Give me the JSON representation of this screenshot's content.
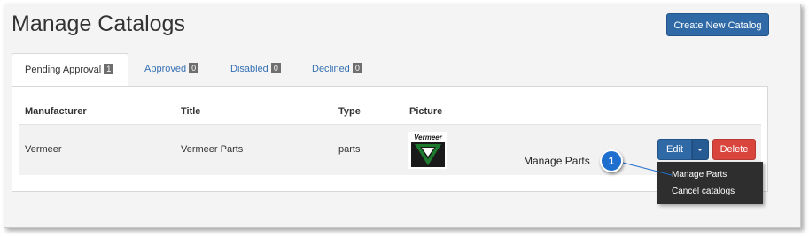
{
  "page": {
    "title": "Manage Catalogs"
  },
  "toolbar": {
    "create_label": "Create New Catalog"
  },
  "tabs": [
    {
      "label": "Pending Approval",
      "count": "1",
      "active": true
    },
    {
      "label": "Approved",
      "count": "0",
      "active": false
    },
    {
      "label": "Disabled",
      "count": "0",
      "active": false
    },
    {
      "label": "Declined",
      "count": "0",
      "active": false
    }
  ],
  "table": {
    "headers": [
      "Manufacturer",
      "Title",
      "Type",
      "Picture"
    ],
    "rows": [
      {
        "manufacturer": "Vermeer",
        "title": "Vermeer Parts",
        "type": "parts",
        "picture_logo_text": "Vermeer"
      }
    ]
  },
  "actions": {
    "edit_label": "Edit",
    "delete_label": "Delete"
  },
  "dropdown": {
    "items": [
      "Manage Parts",
      "Cancel catalogs"
    ]
  },
  "callout": {
    "number": "1",
    "text": "Manage Parts",
    "color": "#1f6fcf"
  },
  "colors": {
    "primary": "#2f6aa6",
    "danger": "#d9453d",
    "badge": "#6e6e6e",
    "logo_green": "#1e7a2d"
  }
}
